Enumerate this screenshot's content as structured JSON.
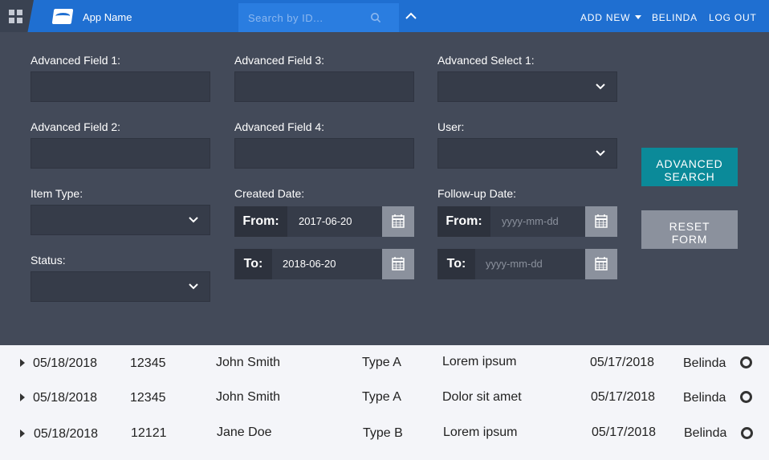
{
  "header": {
    "app_name": "App Name",
    "search_placeholder": "Search by ID...",
    "add_new_label": "ADD NEW",
    "user_label": "BELINDA",
    "logout_label": "LOG OUT",
    "accent_color": "#1f6fd1"
  },
  "form": {
    "adv_field_1": {
      "label": "Advanced Field 1:",
      "value": ""
    },
    "adv_field_2": {
      "label": "Advanced Field 2:",
      "value": ""
    },
    "adv_field_3": {
      "label": "Advanced Field 3:",
      "value": ""
    },
    "adv_field_4": {
      "label": "Advanced Field 4:",
      "value": ""
    },
    "adv_select_1": {
      "label": "Advanced Select 1:",
      "value": ""
    },
    "user": {
      "label": "User:",
      "value": ""
    },
    "item_type": {
      "label": "Item Type:",
      "value": ""
    },
    "status": {
      "label": "Status:",
      "value": ""
    },
    "created_date": {
      "label": "Created Date:",
      "from_label": "From:",
      "from_value": "2017-06-20",
      "to_label": "To:",
      "to_value": "2018-06-20"
    },
    "followup_date": {
      "label": "Follow-up Date:",
      "from_label": "From:",
      "from_placeholder": "yyyy-mm-dd",
      "to_label": "To:",
      "to_placeholder": "yyyy-mm-dd"
    },
    "advanced_search_label": "ADVANCED\nSEARCH",
    "reset_form_label": "RESET\nFORM"
  },
  "results": [
    {
      "date": "05/18/2018",
      "id": "12345",
      "name": "John Smith",
      "type": "Type A",
      "description": "Lorem ipsum",
      "followup": "05/17/2018",
      "user": "Belinda"
    },
    {
      "date": "05/18/2018",
      "id": "12345",
      "name": "John Smith",
      "type": "Type A",
      "description": "Dolor sit amet",
      "followup": "05/17/2018",
      "user": "Belinda"
    },
    {
      "date": "05/18/2018",
      "id": "12121",
      "name": "Jane Doe",
      "type": "Type B",
      "description": "Lorem ipsum",
      "followup": "05/17/2018",
      "user": "Belinda"
    }
  ]
}
